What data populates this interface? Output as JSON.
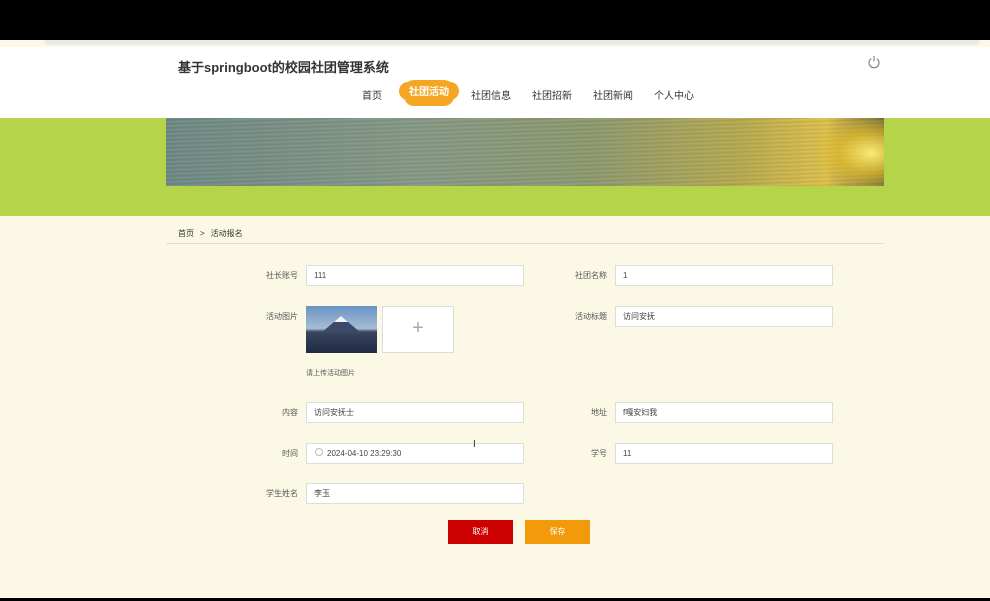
{
  "app": {
    "title": "基于springboot的校园社团管理系统"
  },
  "nav": {
    "items": [
      {
        "label": "首页"
      },
      {
        "label": "社团活动"
      },
      {
        "label": "社团信息"
      },
      {
        "label": "社团招新"
      },
      {
        "label": "社团新闻"
      },
      {
        "label": "个人中心"
      }
    ],
    "active": "社团活动"
  },
  "breadcrumb": {
    "home": "首页",
    "separator": ">",
    "current": "活动报名"
  },
  "form": {
    "president_account": {
      "label": "社长账号",
      "value": "111"
    },
    "club_name": {
      "label": "社团名称",
      "value": "1"
    },
    "activity_image": {
      "label": "活动图片",
      "hint": "请上传活动图片"
    },
    "activity_title": {
      "label": "活动标题",
      "value": "访问安抚"
    },
    "content": {
      "label": "内容",
      "value": "访问安抚士"
    },
    "address": {
      "label": "地址",
      "value": "f嘎安妇我"
    },
    "time": {
      "label": "时间",
      "value": "2024-04-10 23:29:30"
    },
    "student_id": {
      "label": "学号",
      "value": "11"
    },
    "student_name": {
      "label": "学生姓名",
      "value": "李玉"
    }
  },
  "buttons": {
    "cancel": "取消",
    "save": "保存"
  },
  "colors": {
    "accent_orange": "#f39a0a",
    "cancel_red": "#cc0000",
    "band_green": "#b5d44a",
    "page_bg": "#fbf9e6"
  },
  "icons": {
    "power": "power-icon",
    "upload": "plus-icon",
    "time": "clock-icon"
  }
}
